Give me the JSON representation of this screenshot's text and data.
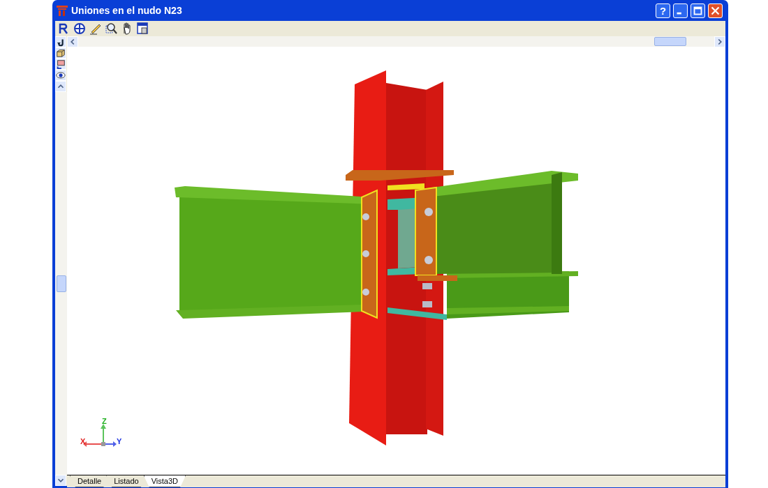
{
  "window": {
    "title": "Uniones en el nudo N23",
    "help_button": "?"
  },
  "axes": [
    {
      "kind": "z",
      "label": "Z"
    },
    {
      "kind": "x",
      "label": "X"
    },
    {
      "kind": "y",
      "label": "Y"
    }
  ],
  "tabs": [
    {
      "label": "Detalle",
      "selected": false
    },
    {
      "label": "Listado",
      "selected": false
    },
    {
      "label": "Vista3D",
      "selected": true
    }
  ]
}
